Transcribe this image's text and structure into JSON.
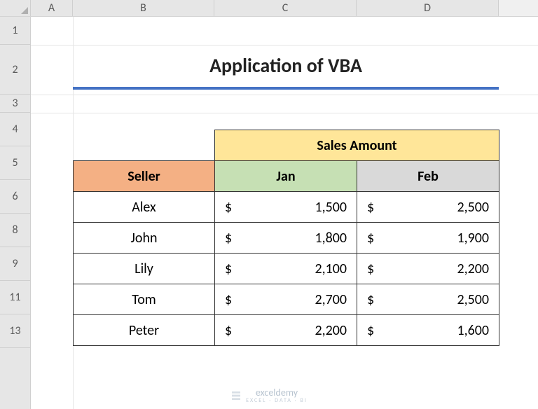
{
  "columns": {
    "A": "A",
    "B": "B",
    "C": "C",
    "D": "D"
  },
  "rows": [
    "1",
    "2",
    "3",
    "4",
    "5",
    "6",
    "8",
    "9",
    "11",
    "13"
  ],
  "title": "Application of VBA",
  "headers": {
    "salesAmount": "Sales Amount",
    "seller": "Seller",
    "jan": "Jan",
    "feb": "Feb"
  },
  "currency": "$",
  "data": [
    {
      "seller": "Alex",
      "jan": "1,500",
      "feb": "2,500"
    },
    {
      "seller": "John",
      "jan": "1,800",
      "feb": "1,900"
    },
    {
      "seller": "Lily",
      "jan": "2,100",
      "feb": "2,200"
    },
    {
      "seller": "Tom",
      "jan": "2,700",
      "feb": "2,500"
    },
    {
      "seller": "Peter",
      "jan": "2,200",
      "feb": "1,600"
    }
  ],
  "watermark": {
    "brand": "exceldemy",
    "tagline": "EXCEL · DATA · BI"
  },
  "chart_data": {
    "type": "table",
    "title": "Application of VBA",
    "columns": [
      "Seller",
      "Jan",
      "Feb"
    ],
    "rows": [
      [
        "Alex",
        1500,
        2500
      ],
      [
        "John",
        1800,
        1900
      ],
      [
        "Lily",
        2100,
        2200
      ],
      [
        "Tom",
        2700,
        2500
      ],
      [
        "Peter",
        2200,
        1600
      ]
    ],
    "value_label": "Sales Amount",
    "currency": "USD"
  }
}
